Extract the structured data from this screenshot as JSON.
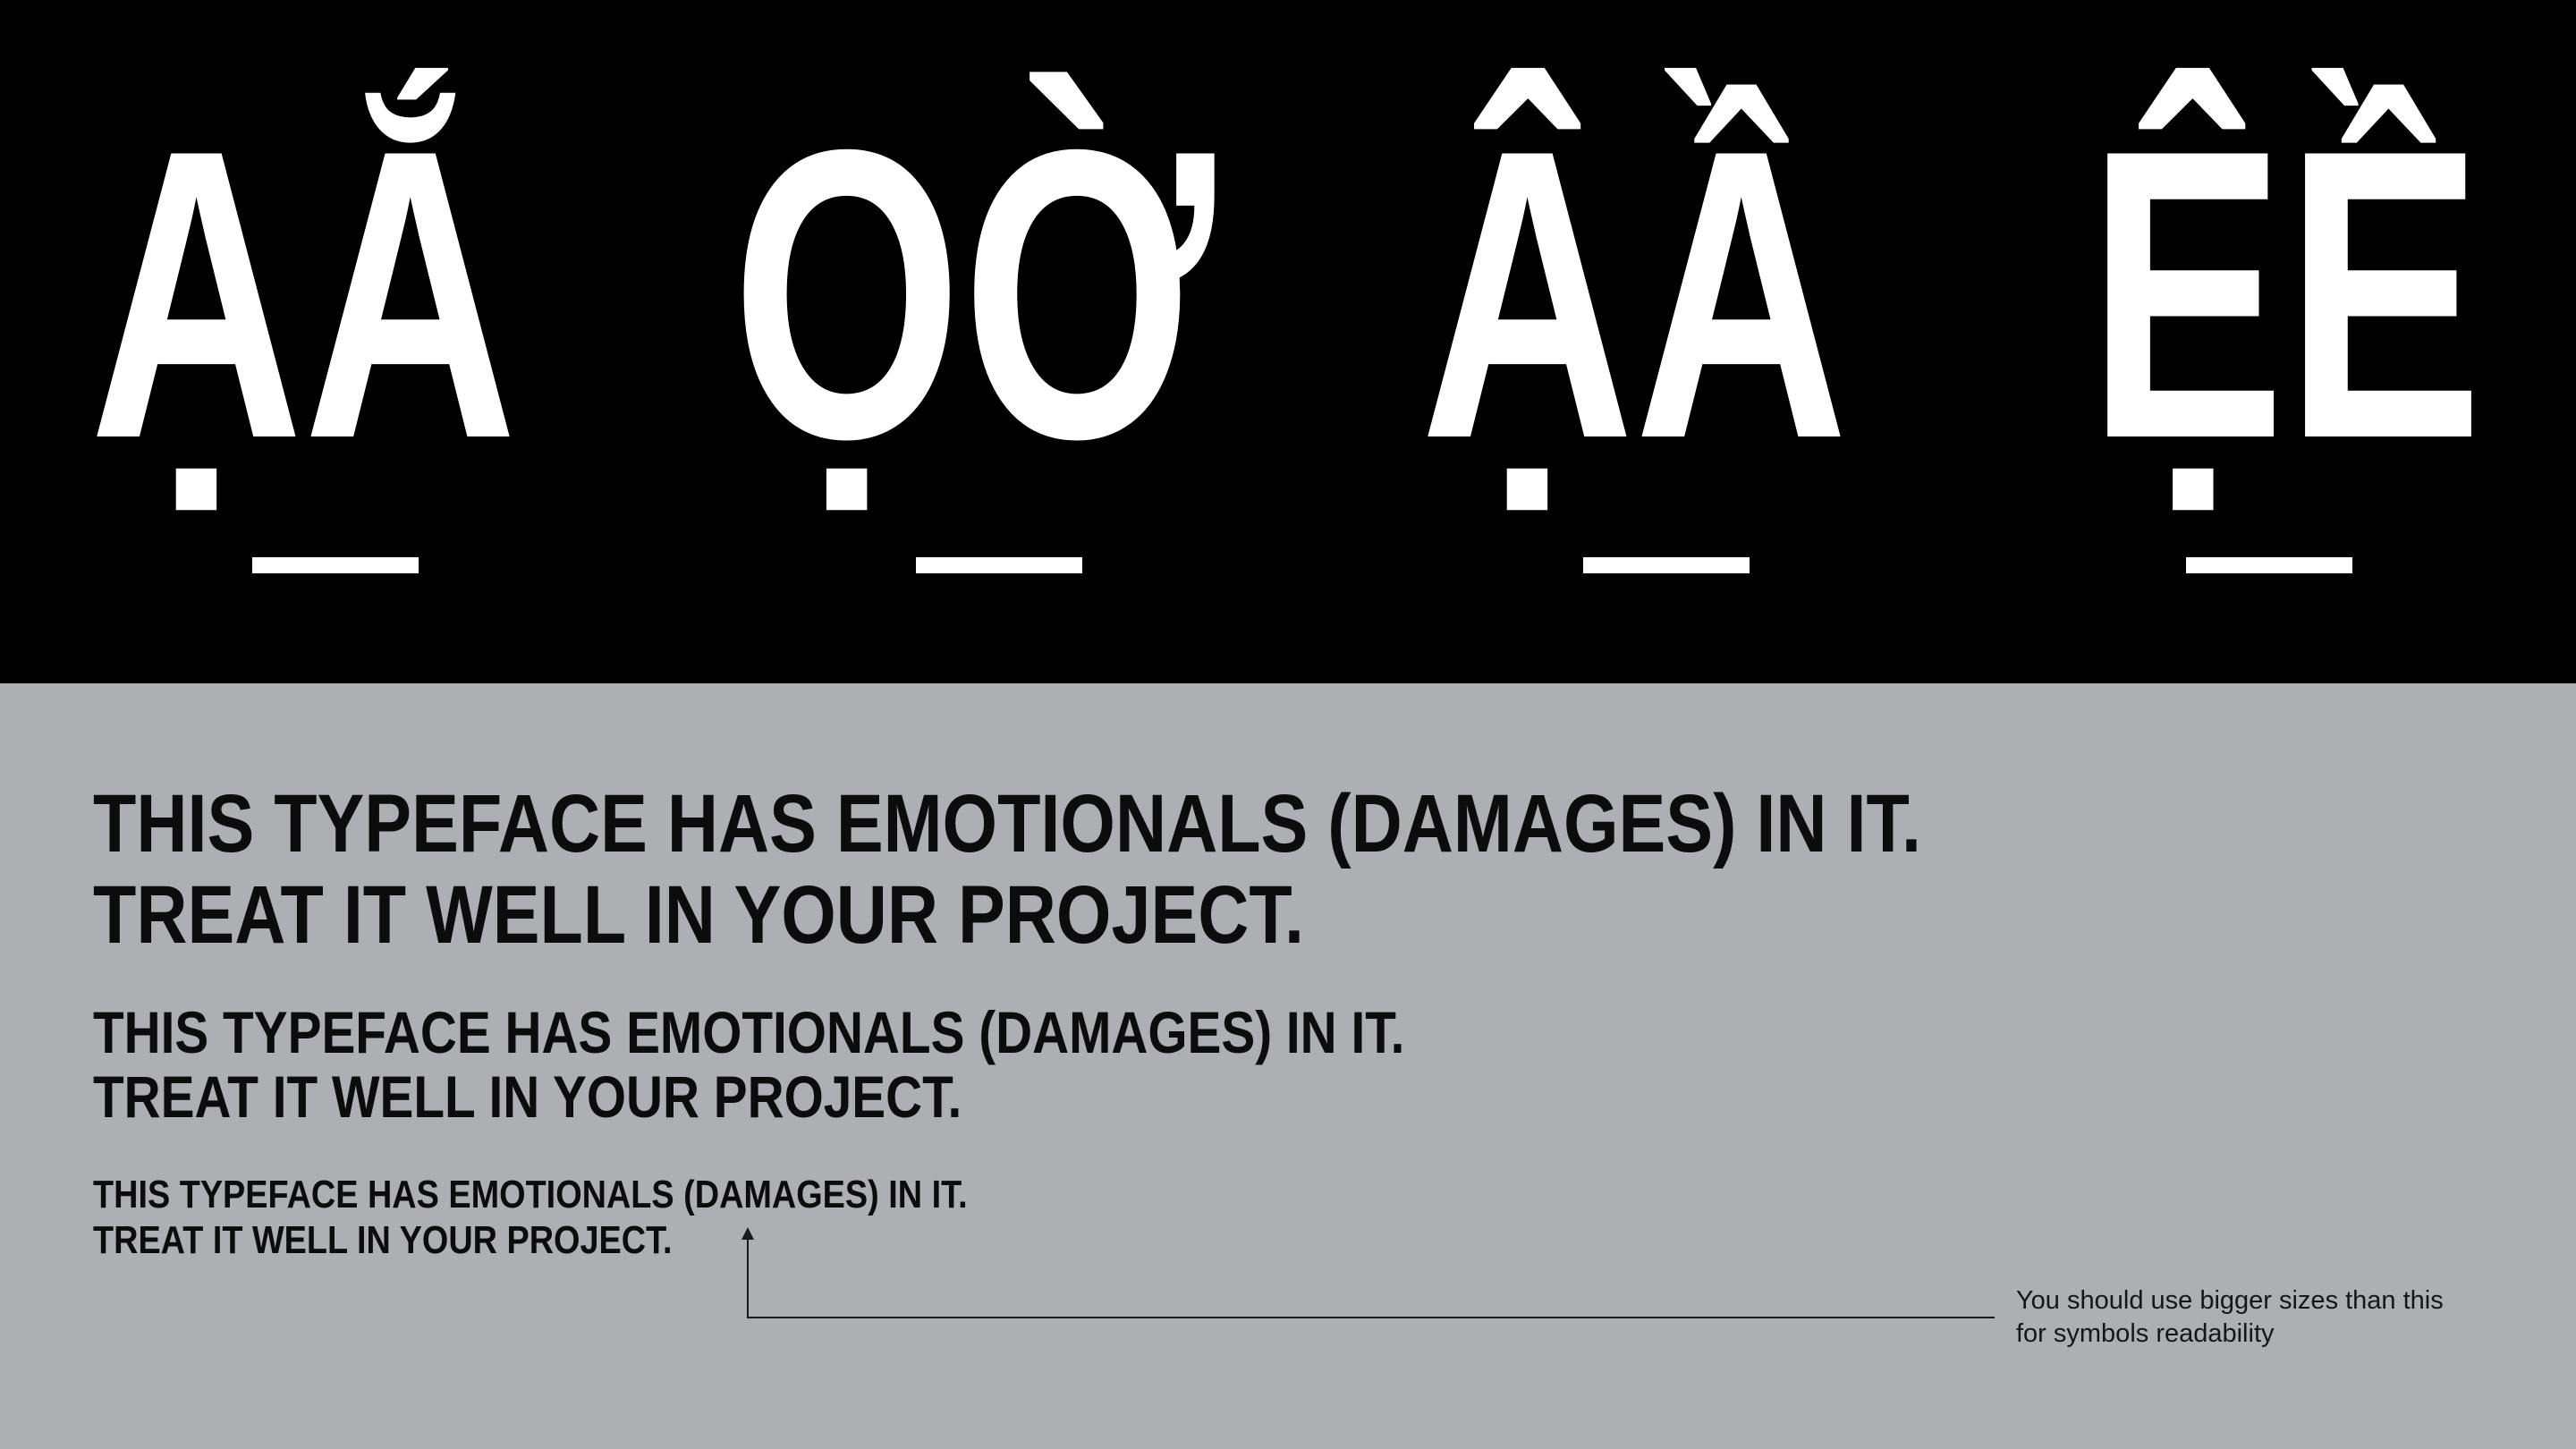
{
  "hero": {
    "groups": [
      {
        "glyphs": "ẠẮ"
      },
      {
        "glyphs": "ỌỜ"
      },
      {
        "glyphs": "ẬẦ"
      },
      {
        "glyphs": "ỆỀ"
      }
    ]
  },
  "samples": {
    "large": {
      "line1": "THIS TYPEFACE HAS EMOTIONALS (DAMAGES) IN IT.",
      "line2": "TREAT IT WELL IN YOUR PROJECT."
    },
    "medium": {
      "line1": "THIS TYPEFACE HAS EMOTIONALS (DAMAGES) IN IT.",
      "line2": "TREAT IT WELL IN YOUR PROJECT."
    },
    "small": {
      "line1": "THIS TYPEFACE HAS EMOTIONALS (DAMAGES) IN IT.",
      "line2": "TREAT IT WELL IN YOUR PROJECT."
    }
  },
  "note": {
    "line1": "You should use bigger sizes than this",
    "line2": "for symbols readability"
  },
  "colors": {
    "hero_background": "#000000",
    "glyph_color": "#ffffff",
    "page_background": "#aeafb3",
    "text_color": "#0c0c0c"
  },
  "icons": [
    "arrow-up-icon"
  ]
}
